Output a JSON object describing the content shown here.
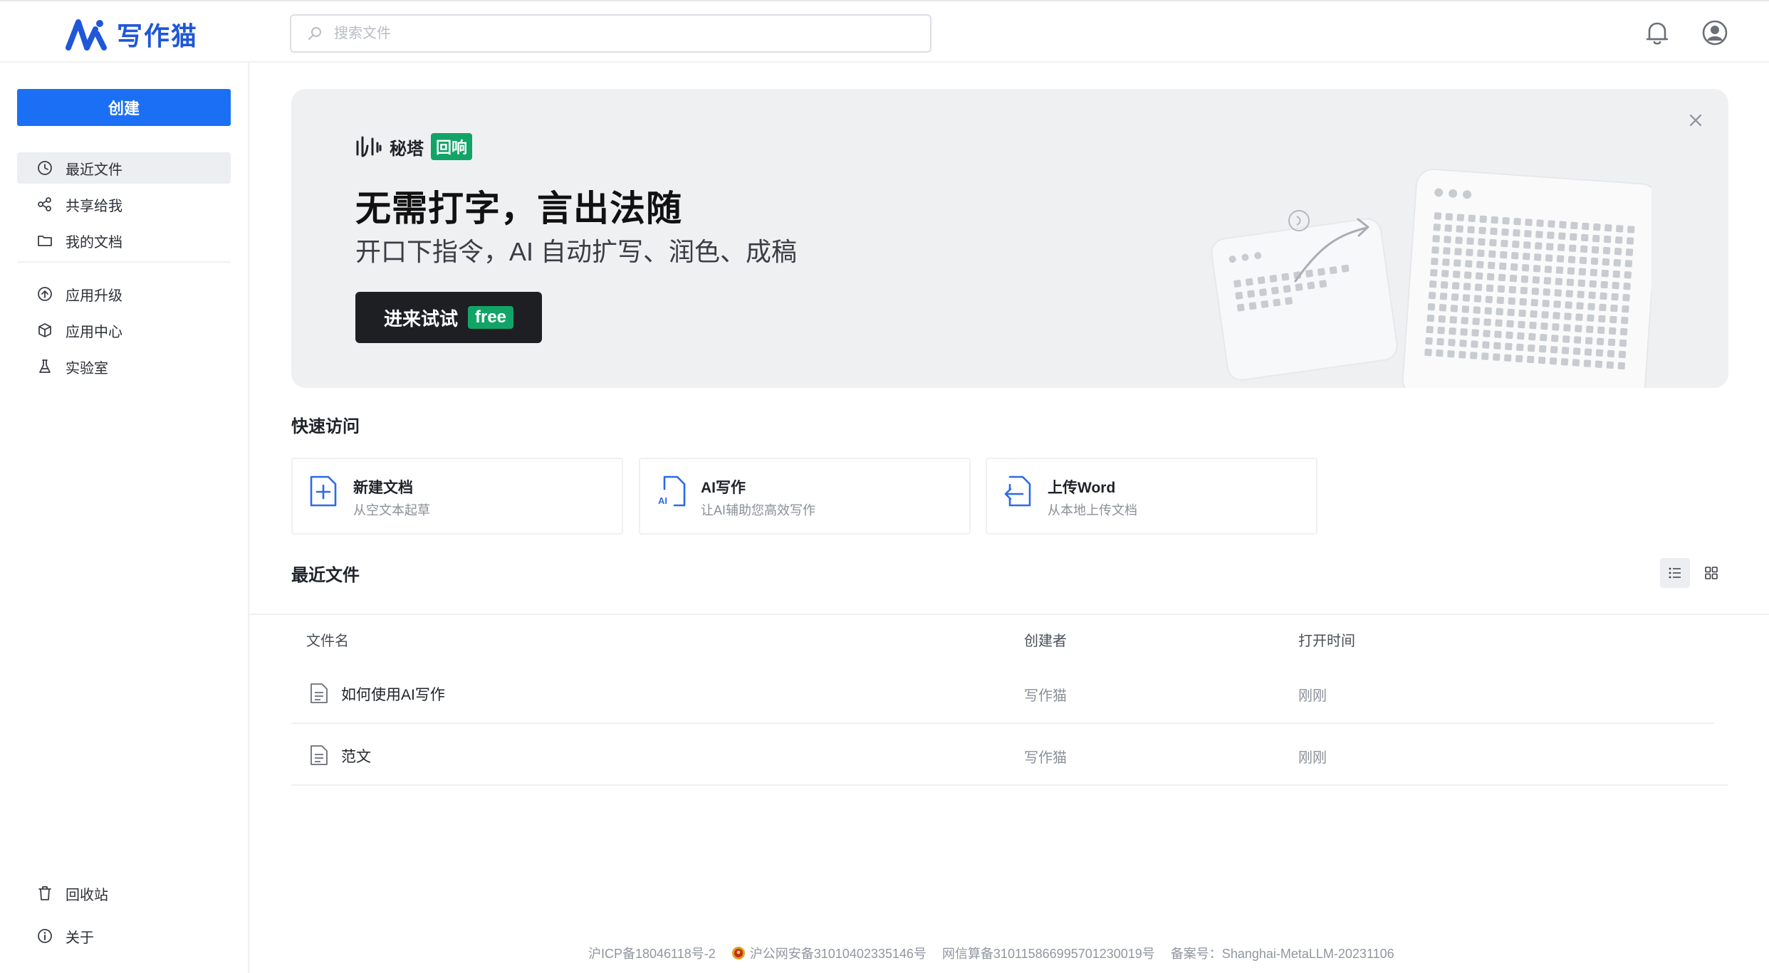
{
  "header": {
    "logo_text": "写作猫",
    "search_placeholder": "搜索文件"
  },
  "sidebar": {
    "create_label": "创建",
    "items": [
      {
        "label": "最近文件"
      },
      {
        "label": "共享给我"
      },
      {
        "label": "我的文档"
      },
      {
        "label": "应用升级"
      },
      {
        "label": "应用中心"
      },
      {
        "label": "实验室"
      }
    ],
    "bottom_items": [
      {
        "label": "回收站"
      },
      {
        "label": "关于"
      }
    ]
  },
  "banner": {
    "brand_name": "秘塔",
    "brand_badge": "回响",
    "title": "无需打字，言出法随",
    "subtitle": "开口下指令，AI 自动扩写、润色、成稿",
    "button_label": "进来试试",
    "free_tag": "free"
  },
  "quick_access": {
    "title": "快速访问",
    "cards": [
      {
        "title": "新建文档",
        "desc": "从空文本起草"
      },
      {
        "title": "AI写作",
        "desc": "让AI辅助您高效写作"
      },
      {
        "title": "上传Word",
        "desc": "从本地上传文档"
      }
    ]
  },
  "recent": {
    "title": "最近文件",
    "columns": [
      "文件名",
      "创建者",
      "打开时间"
    ],
    "rows": [
      {
        "name": "如何使用AI写作",
        "creator": "写作猫",
        "time": "刚刚"
      },
      {
        "name": "范文",
        "creator": "写作猫",
        "time": "刚刚"
      }
    ]
  },
  "footer": {
    "icp": "沪ICP备18046118号-2",
    "police": "沪公网安备31010402335146号",
    "algo": "网信算备310115866995701230019号",
    "record": "备案号：Shanghai-MetaLLM-20231106"
  },
  "colors": {
    "primary": "#1a6ff5",
    "logo": "#1f57d8",
    "badge_green": "#12a466",
    "banner_bg": "#eff0f2",
    "dark_button": "#1d1f23"
  }
}
